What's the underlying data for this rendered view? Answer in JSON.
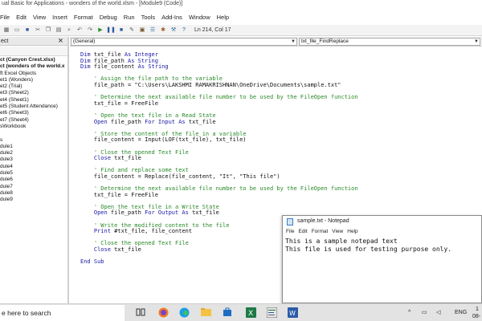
{
  "window": {
    "title": "ual Basic for Applications - wonders of the world.xlsm - [Module9 (Code)]"
  },
  "menu": [
    "File",
    "Edit",
    "View",
    "Insert",
    "Format",
    "Debug",
    "Run",
    "Tools",
    "Add-Ins",
    "Window",
    "Help"
  ],
  "toolbar": {
    "position": "Ln 214, Col 17"
  },
  "project_explorer": {
    "title": "ect",
    "tree": [
      "ct (Canyon Crest.xlsx)",
      "ct (wonders of the world.x",
      "ft Excel Objects",
      "et1 (Wonders)",
      "et2 (Trial)",
      "et3 (Sheet2)",
      "et4 (Sheet1)",
      "et5 (Student Attendance)",
      "et6 (Sheet3)",
      "et7 (Sheet4)",
      "sWorkbook",
      "",
      "s",
      "dule1",
      "dule2",
      "dule3",
      "dule4",
      "dule5",
      "dule6",
      "dule7",
      "dule8",
      "dule9"
    ]
  },
  "code_window": {
    "object_combo": "(General)",
    "procedure_combo": "txt_file_FindReplace",
    "lines": [
      [
        {
          "t": "Dim",
          "c": "kw"
        },
        {
          "t": " txt_file "
        },
        {
          "t": "As Integer",
          "c": "kw"
        }
      ],
      [
        {
          "t": "Dim",
          "c": "kw"
        },
        {
          "t": " file_path "
        },
        {
          "t": "As String",
          "c": "kw"
        }
      ],
      [
        {
          "t": "Dim",
          "c": "kw"
        },
        {
          "t": " file_content "
        },
        {
          "t": "As String",
          "c": "kw"
        }
      ],
      [],
      [
        {
          "t": "' Assign the file path to the variable",
          "c": "cm"
        }
      ],
      [
        {
          "t": "file_path = \"C:\\Users\\LAKSHMI RAMAKRISHNAN\\OneDrive\\Documents\\sample.txt\""
        }
      ],
      [],
      [
        {
          "t": "' Determine the next available file number to be used by the FileOpen function",
          "c": "cm"
        }
      ],
      [
        {
          "t": "txt_file = FreeFile"
        }
      ],
      [],
      [
        {
          "t": "' Open the text file in a Read State",
          "c": "cm"
        }
      ],
      [
        {
          "t": "Open",
          "c": "kw"
        },
        {
          "t": " file_path "
        },
        {
          "t": "For Input As",
          "c": "kw"
        },
        {
          "t": " txt_file"
        }
      ],
      [],
      [
        {
          "t": "' Store the content of the file in a variable",
          "c": "cm"
        }
      ],
      [
        {
          "t": "file_content = Input(LOF(txt_file), txt_file)"
        }
      ],
      [],
      [
        {
          "t": "' Close the opened Text File",
          "c": "cm"
        }
      ],
      [
        {
          "t": "Close",
          "c": "kw"
        },
        {
          "t": " txt_file"
        }
      ],
      [],
      [
        {
          "t": "' Find and replace some text",
          "c": "cm"
        }
      ],
      [
        {
          "t": "file_content = Replace(file_content, \"It\", \"This file\")"
        }
      ],
      [],
      [
        {
          "t": "' Determine the next available file number to be used by the FileOpen function",
          "c": "cm"
        }
      ],
      [
        {
          "t": "txt_file = FreeFile"
        }
      ],
      [],
      [
        {
          "t": "' Open the text file in a Write State",
          "c": "cm"
        }
      ],
      [
        {
          "t": "Open",
          "c": "kw"
        },
        {
          "t": " file_path "
        },
        {
          "t": "For Output As",
          "c": "kw"
        },
        {
          "t": " txt_file"
        }
      ],
      [],
      [
        {
          "t": "' Write the modified content to the file",
          "c": "cm"
        }
      ],
      [
        {
          "t": "Print",
          "c": "kw"
        },
        {
          "t": " #txt_file, file_content"
        }
      ],
      [],
      [
        {
          "t": "' Close the opened Text File",
          "c": "cm"
        }
      ],
      [
        {
          "t": "Close",
          "c": "kw"
        },
        {
          "t": " txt_file"
        }
      ],
      [],
      [
        {
          "t": "End Sub",
          "c": "kw"
        }
      ]
    ]
  },
  "notepad": {
    "title": "sample.txt - Notepad",
    "menu": [
      "File",
      "Edit",
      "Format",
      "View",
      "Help"
    ],
    "lines": [
      "This is a sample notepad text",
      "This file is used for testing purpose only."
    ]
  },
  "taskbar": {
    "search_text": "e here to search",
    "language": "ENG",
    "time": "1",
    "date": "08-0"
  },
  "colors": {
    "keyword": "#1a1aa6",
    "comment": "#2a8a2a"
  }
}
